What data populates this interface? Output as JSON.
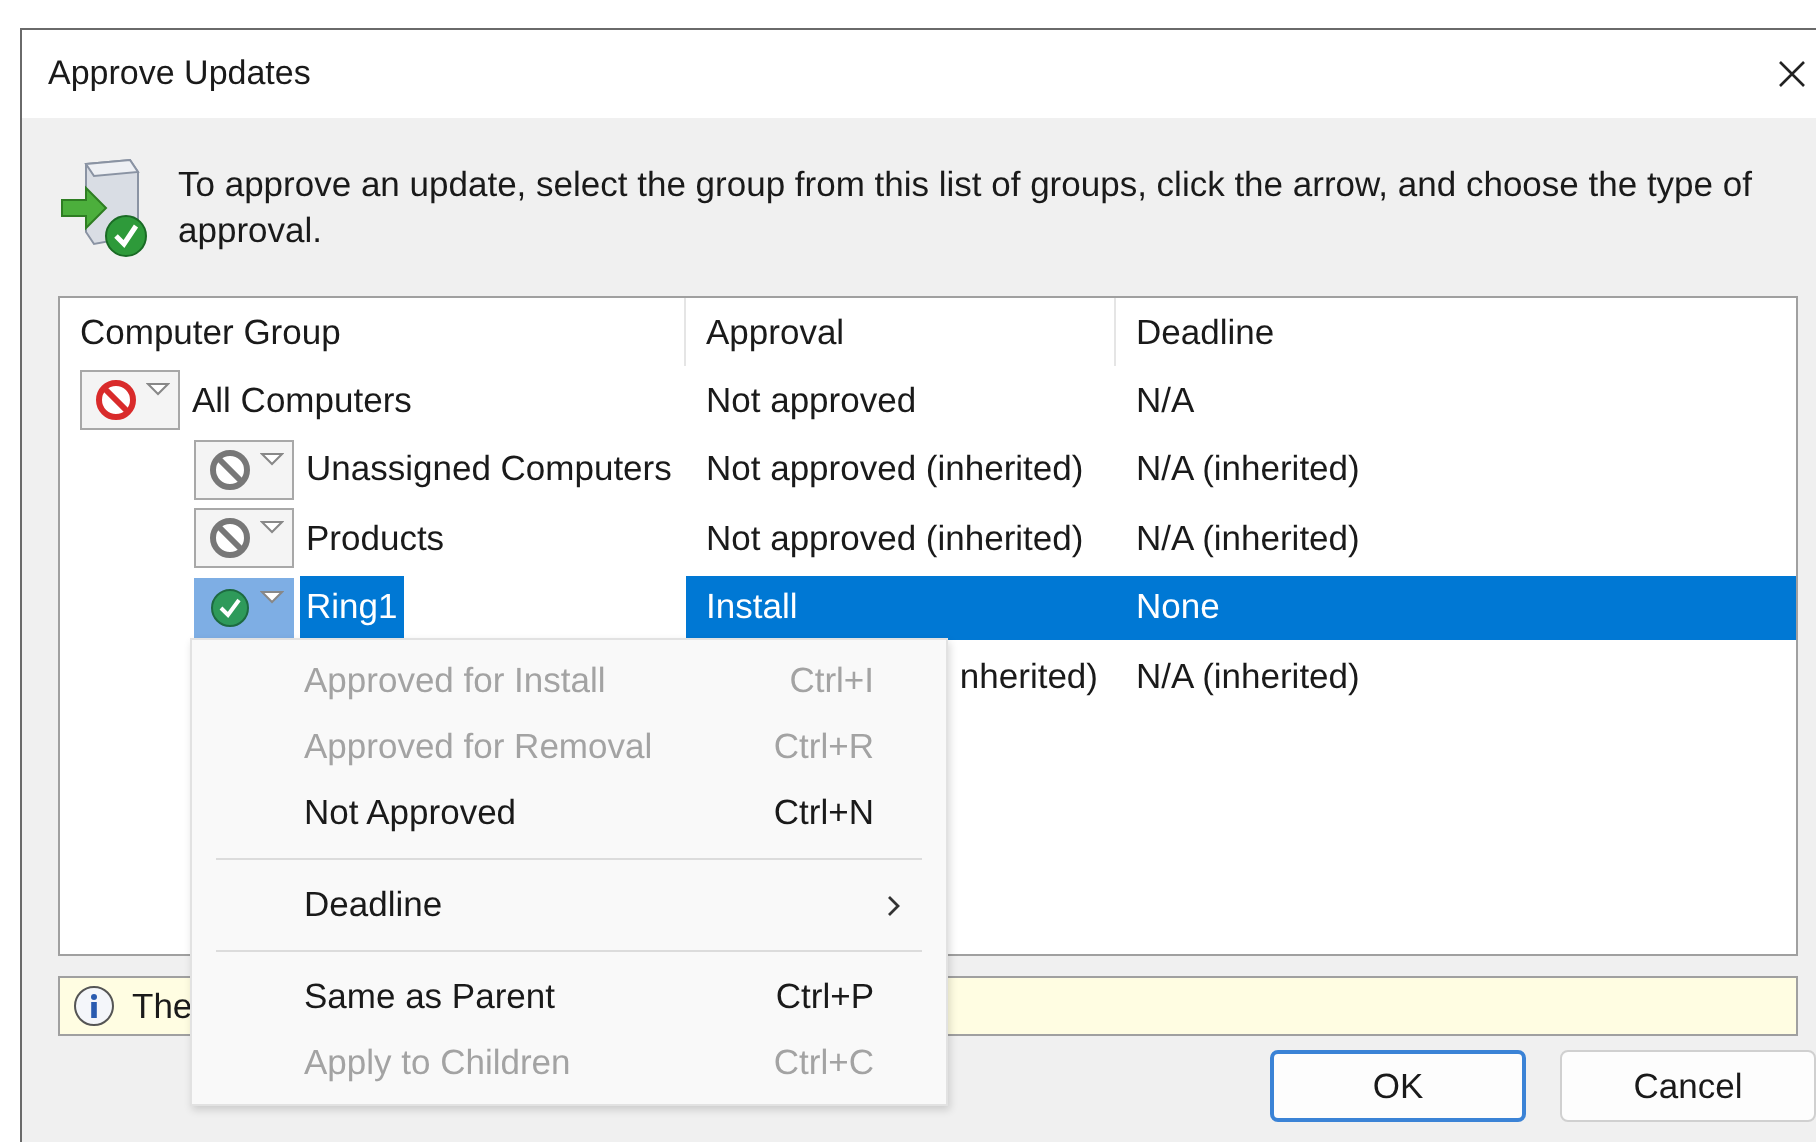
{
  "window": {
    "title": "Approve Updates"
  },
  "instructions": "To approve an update, select the group from this list of groups, click the arrow, and choose the type of approval.",
  "table": {
    "columns": [
      "Computer Group",
      "Approval",
      "Deadline"
    ],
    "rows": [
      {
        "group": "All Computers",
        "kind": "denied",
        "approval": "Not approved",
        "deadline": "N/A",
        "selected": false,
        "children": [
          {
            "group": "Unassigned Computers",
            "kind": "inherited",
            "approval": "Not approved (inherited)",
            "deadline": "N/A (inherited)",
            "selected": false
          },
          {
            "group": "Products",
            "kind": "inherited",
            "approval": "Not approved (inherited)",
            "deadline": "N/A (inherited)",
            "selected": false
          },
          {
            "group": "Ring1",
            "kind": "approved",
            "approval": "Install",
            "deadline": "None",
            "selected": true
          },
          {
            "approval": "nherited)",
            "deadline": "N/A (inherited)",
            "selected": false
          }
        ]
      }
    ]
  },
  "status_bar": {
    "text": "The"
  },
  "buttons": [
    {
      "label": "OK",
      "default": true
    },
    {
      "label": "Cancel",
      "default": false
    }
  ],
  "context_menu": [
    {
      "kind": "item",
      "label": "Approved for Install",
      "shortcut": "Ctrl+I",
      "disabled": true
    },
    {
      "kind": "item",
      "label": "Approved for Removal",
      "shortcut": "Ctrl+R",
      "disabled": true
    },
    {
      "kind": "item",
      "label": "Not Approved",
      "shortcut": "Ctrl+N",
      "disabled": false
    },
    {
      "kind": "separator"
    },
    {
      "kind": "submenu",
      "label": "Deadline",
      "disabled": false
    },
    {
      "kind": "separator"
    },
    {
      "kind": "item",
      "label": "Same as Parent",
      "shortcut": "Ctrl+P",
      "disabled": false
    },
    {
      "kind": "item",
      "label": "Apply to Children",
      "shortcut": "Ctrl+C",
      "disabled": true
    }
  ]
}
